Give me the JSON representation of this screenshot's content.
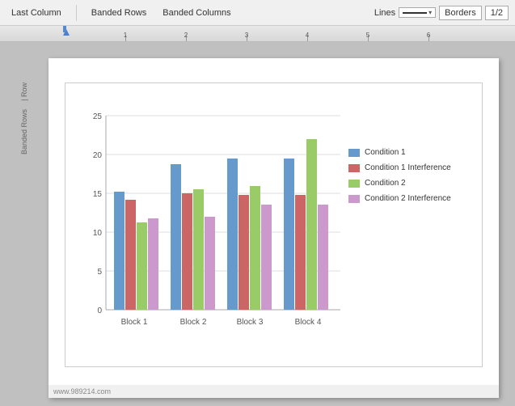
{
  "toolbar": {
    "items": [
      "Last Column",
      "Banded Rows",
      "Banded Columns"
    ],
    "lines_label": "Lines",
    "borders_label": "Borders",
    "page_num": "1/2"
  },
  "ruler": {
    "numbers": [
      "1",
      "2",
      "3",
      "4",
      "5",
      "6"
    ]
  },
  "chart": {
    "title": "",
    "y_axis": {
      "max": 25,
      "ticks": [
        0,
        5,
        10,
        15,
        20,
        25
      ]
    },
    "x_axis": {
      "labels": [
        "Block 1",
        "Block 2",
        "Block 3",
        "Block 4"
      ]
    },
    "legend": [
      {
        "label": "Condition 1",
        "color": "#6699cc"
      },
      {
        "label": "Condition 1 Interference",
        "color": "#cc6666"
      },
      {
        "label": "Condition 2",
        "color": "#99cc66"
      },
      {
        "label": "Condition 2 Interference",
        "color": "#cc99cc"
      }
    ],
    "series": [
      {
        "name": "Condition 1",
        "color": "#6699cc",
        "values": [
          15.2,
          18.8,
          19.5,
          19.5
        ]
      },
      {
        "name": "Condition 1 Interference",
        "color": "#cc6666",
        "values": [
          14.2,
          15.0,
          14.8,
          14.8
        ]
      },
      {
        "name": "Condition 2",
        "color": "#99cc66",
        "values": [
          11.2,
          15.5,
          16.0,
          22.0
        ]
      },
      {
        "name": "Condition 2 Interference",
        "color": "#cc99cc",
        "values": [
          11.8,
          12.0,
          13.5,
          13.5
        ]
      }
    ]
  },
  "url_bar": {
    "text": "www.989214.com"
  }
}
